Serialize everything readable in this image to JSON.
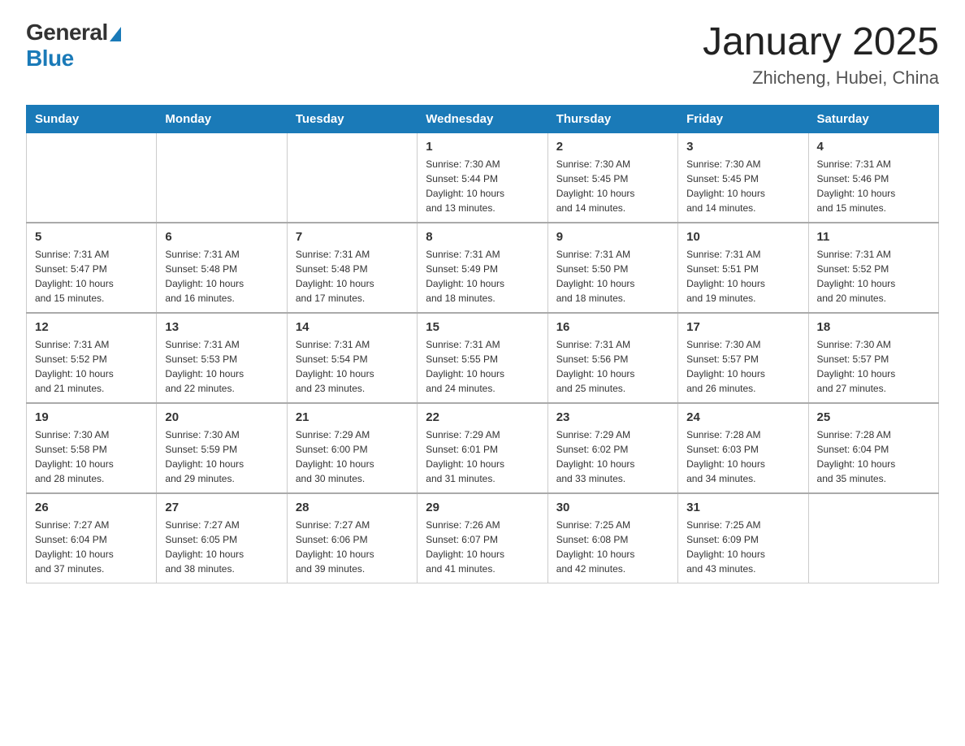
{
  "header": {
    "logo_general": "General",
    "logo_blue": "Blue",
    "title": "January 2025",
    "subtitle": "Zhicheng, Hubei, China"
  },
  "weekdays": [
    "Sunday",
    "Monday",
    "Tuesday",
    "Wednesday",
    "Thursday",
    "Friday",
    "Saturday"
  ],
  "weeks": [
    [
      {
        "day": "",
        "info": ""
      },
      {
        "day": "",
        "info": ""
      },
      {
        "day": "",
        "info": ""
      },
      {
        "day": "1",
        "info": "Sunrise: 7:30 AM\nSunset: 5:44 PM\nDaylight: 10 hours\nand 13 minutes."
      },
      {
        "day": "2",
        "info": "Sunrise: 7:30 AM\nSunset: 5:45 PM\nDaylight: 10 hours\nand 14 minutes."
      },
      {
        "day": "3",
        "info": "Sunrise: 7:30 AM\nSunset: 5:45 PM\nDaylight: 10 hours\nand 14 minutes."
      },
      {
        "day": "4",
        "info": "Sunrise: 7:31 AM\nSunset: 5:46 PM\nDaylight: 10 hours\nand 15 minutes."
      }
    ],
    [
      {
        "day": "5",
        "info": "Sunrise: 7:31 AM\nSunset: 5:47 PM\nDaylight: 10 hours\nand 15 minutes."
      },
      {
        "day": "6",
        "info": "Sunrise: 7:31 AM\nSunset: 5:48 PM\nDaylight: 10 hours\nand 16 minutes."
      },
      {
        "day": "7",
        "info": "Sunrise: 7:31 AM\nSunset: 5:48 PM\nDaylight: 10 hours\nand 17 minutes."
      },
      {
        "day": "8",
        "info": "Sunrise: 7:31 AM\nSunset: 5:49 PM\nDaylight: 10 hours\nand 18 minutes."
      },
      {
        "day": "9",
        "info": "Sunrise: 7:31 AM\nSunset: 5:50 PM\nDaylight: 10 hours\nand 18 minutes."
      },
      {
        "day": "10",
        "info": "Sunrise: 7:31 AM\nSunset: 5:51 PM\nDaylight: 10 hours\nand 19 minutes."
      },
      {
        "day": "11",
        "info": "Sunrise: 7:31 AM\nSunset: 5:52 PM\nDaylight: 10 hours\nand 20 minutes."
      }
    ],
    [
      {
        "day": "12",
        "info": "Sunrise: 7:31 AM\nSunset: 5:52 PM\nDaylight: 10 hours\nand 21 minutes."
      },
      {
        "day": "13",
        "info": "Sunrise: 7:31 AM\nSunset: 5:53 PM\nDaylight: 10 hours\nand 22 minutes."
      },
      {
        "day": "14",
        "info": "Sunrise: 7:31 AM\nSunset: 5:54 PM\nDaylight: 10 hours\nand 23 minutes."
      },
      {
        "day": "15",
        "info": "Sunrise: 7:31 AM\nSunset: 5:55 PM\nDaylight: 10 hours\nand 24 minutes."
      },
      {
        "day": "16",
        "info": "Sunrise: 7:31 AM\nSunset: 5:56 PM\nDaylight: 10 hours\nand 25 minutes."
      },
      {
        "day": "17",
        "info": "Sunrise: 7:30 AM\nSunset: 5:57 PM\nDaylight: 10 hours\nand 26 minutes."
      },
      {
        "day": "18",
        "info": "Sunrise: 7:30 AM\nSunset: 5:57 PM\nDaylight: 10 hours\nand 27 minutes."
      }
    ],
    [
      {
        "day": "19",
        "info": "Sunrise: 7:30 AM\nSunset: 5:58 PM\nDaylight: 10 hours\nand 28 minutes."
      },
      {
        "day": "20",
        "info": "Sunrise: 7:30 AM\nSunset: 5:59 PM\nDaylight: 10 hours\nand 29 minutes."
      },
      {
        "day": "21",
        "info": "Sunrise: 7:29 AM\nSunset: 6:00 PM\nDaylight: 10 hours\nand 30 minutes."
      },
      {
        "day": "22",
        "info": "Sunrise: 7:29 AM\nSunset: 6:01 PM\nDaylight: 10 hours\nand 31 minutes."
      },
      {
        "day": "23",
        "info": "Sunrise: 7:29 AM\nSunset: 6:02 PM\nDaylight: 10 hours\nand 33 minutes."
      },
      {
        "day": "24",
        "info": "Sunrise: 7:28 AM\nSunset: 6:03 PM\nDaylight: 10 hours\nand 34 minutes."
      },
      {
        "day": "25",
        "info": "Sunrise: 7:28 AM\nSunset: 6:04 PM\nDaylight: 10 hours\nand 35 minutes."
      }
    ],
    [
      {
        "day": "26",
        "info": "Sunrise: 7:27 AM\nSunset: 6:04 PM\nDaylight: 10 hours\nand 37 minutes."
      },
      {
        "day": "27",
        "info": "Sunrise: 7:27 AM\nSunset: 6:05 PM\nDaylight: 10 hours\nand 38 minutes."
      },
      {
        "day": "28",
        "info": "Sunrise: 7:27 AM\nSunset: 6:06 PM\nDaylight: 10 hours\nand 39 minutes."
      },
      {
        "day": "29",
        "info": "Sunrise: 7:26 AM\nSunset: 6:07 PM\nDaylight: 10 hours\nand 41 minutes."
      },
      {
        "day": "30",
        "info": "Sunrise: 7:25 AM\nSunset: 6:08 PM\nDaylight: 10 hours\nand 42 minutes."
      },
      {
        "day": "31",
        "info": "Sunrise: 7:25 AM\nSunset: 6:09 PM\nDaylight: 10 hours\nand 43 minutes."
      },
      {
        "day": "",
        "info": ""
      }
    ]
  ]
}
